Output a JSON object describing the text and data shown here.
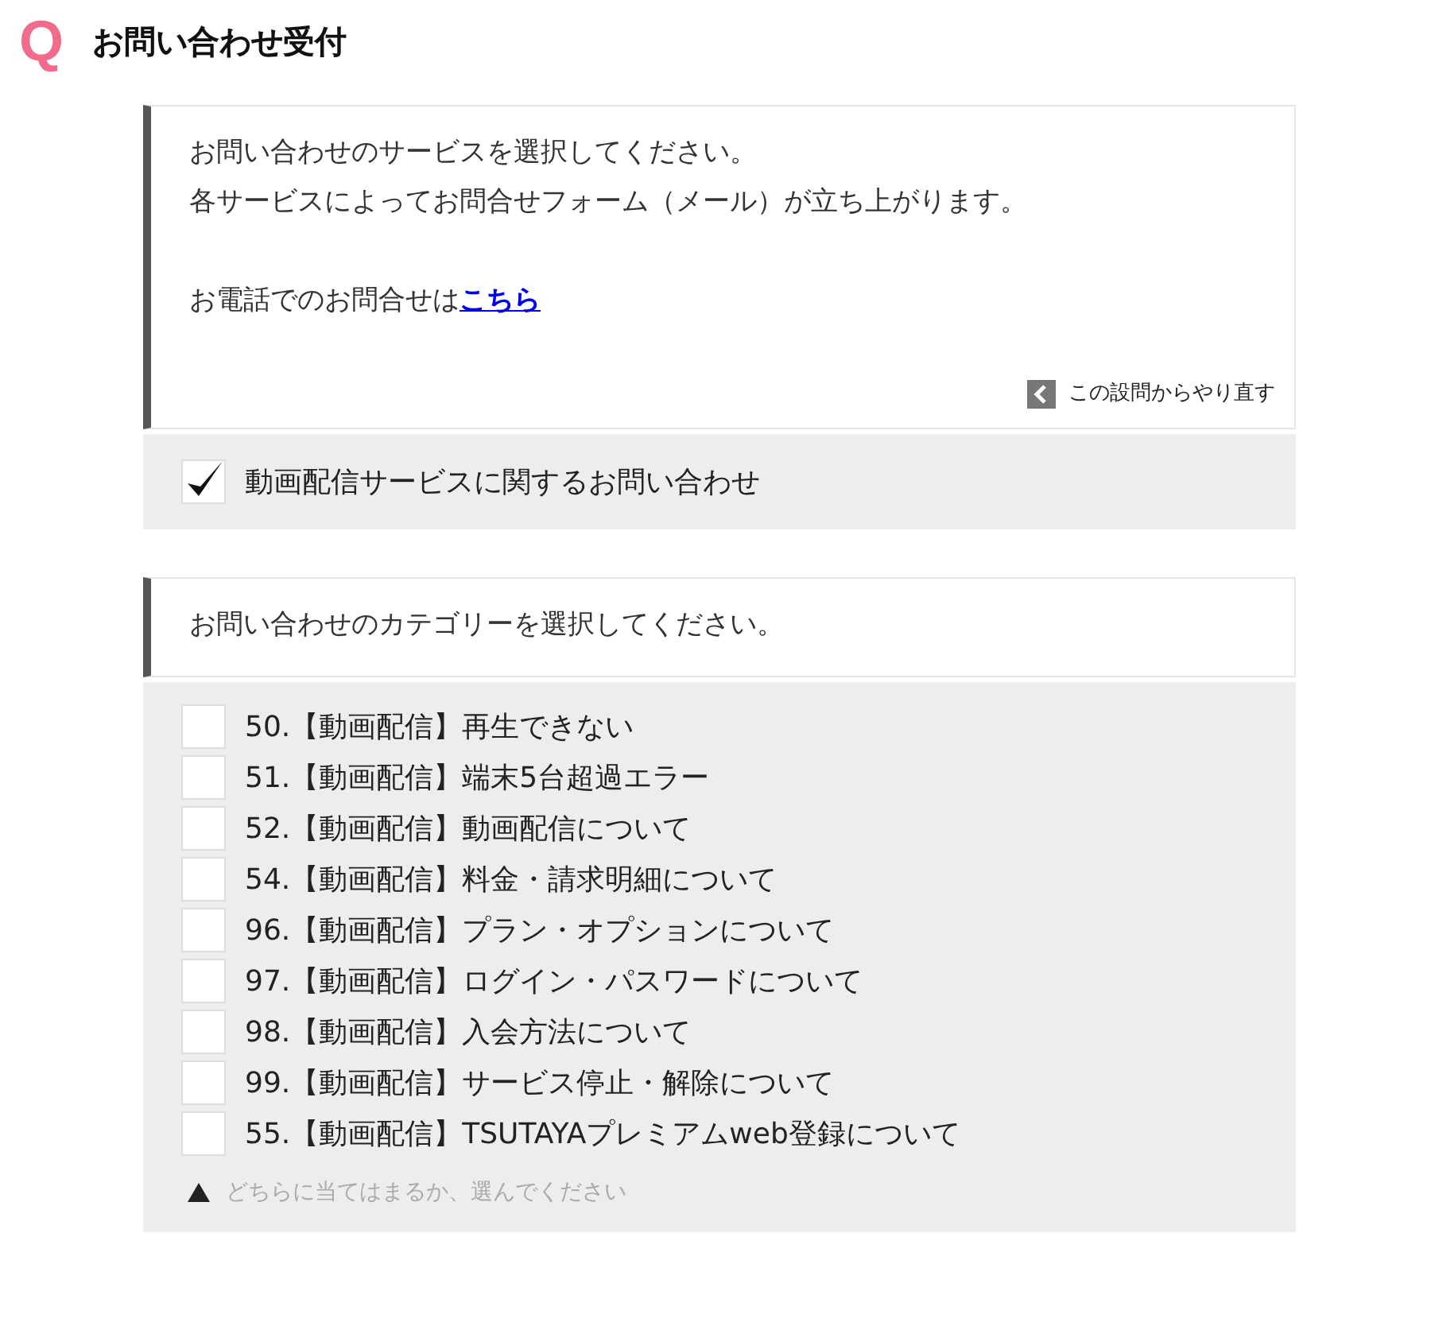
{
  "header": {
    "icon_letter": "Q",
    "title": "お問い合わせ受付"
  },
  "questions": [
    {
      "lines": [
        "お問い合わせのサービスを選択してください。",
        "各サービスによってお問合せフォーム（メール）が立ち上がります。"
      ],
      "phone_text": "お電話でのお問合せは",
      "phone_link": "こちら",
      "back_link": "この設問からやり直す",
      "options": [
        {
          "label": "動画配信サービスに関するお問い合わせ",
          "checked": true
        }
      ]
    },
    {
      "lines": [
        "お問い合わせのカテゴリーを選択してください。"
      ],
      "options": [
        {
          "label": "50.【動画配信】再生できない",
          "checked": false
        },
        {
          "label": "51.【動画配信】端末5台超過エラー",
          "checked": false
        },
        {
          "label": "52.【動画配信】動画配信について",
          "checked": false
        },
        {
          "label": "54.【動画配信】料金・請求明細について",
          "checked": false
        },
        {
          "label": "96.【動画配信】プラン・オプションについて",
          "checked": false
        },
        {
          "label": "97.【動画配信】ログイン・パスワードについて",
          "checked": false
        },
        {
          "label": "98.【動画配信】入会方法について",
          "checked": false
        },
        {
          "label": "99.【動画配信】サービス停止・解除について",
          "checked": false
        },
        {
          "label": "55.【動画配信】TSUTAYAプレミアムweb登録について",
          "checked": false
        }
      ],
      "hint": "どちらに当てはまるか、選んでください"
    }
  ]
}
